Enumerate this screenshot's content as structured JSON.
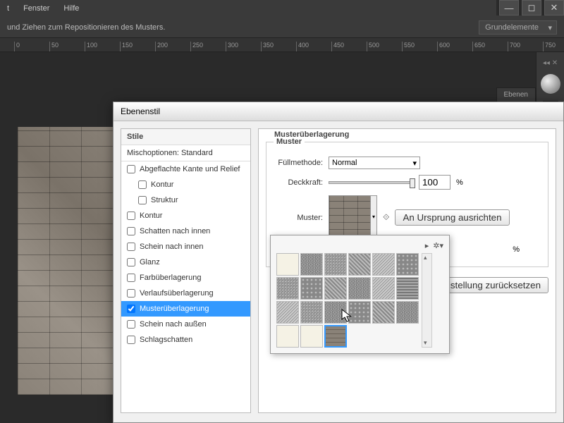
{
  "menu": {
    "item1": "t",
    "item2": "Fenster",
    "item3": "Hilfe"
  },
  "toolbar": {
    "hint": "und Ziehen zum Repositionieren des Musters.",
    "preset": "Grundelemente"
  },
  "ruler": [
    "0",
    "50",
    "100",
    "150",
    "200",
    "250",
    "300",
    "350",
    "400",
    "450",
    "500",
    "550",
    "600",
    "650",
    "700",
    "750"
  ],
  "panel_tab": "Ebenen",
  "dialog": {
    "title": "Ebenenstil",
    "styles_header": "Stile",
    "blend_options": "Mischoptionen: Standard",
    "items": [
      {
        "label": "Abgeflachte Kante und Relief",
        "checked": false
      },
      {
        "label": "Kontur",
        "checked": false,
        "indent": true
      },
      {
        "label": "Struktur",
        "checked": false,
        "indent": true
      },
      {
        "label": "Kontur",
        "checked": false
      },
      {
        "label": "Schatten nach innen",
        "checked": false
      },
      {
        "label": "Schein nach innen",
        "checked": false
      },
      {
        "label": "Glanz",
        "checked": false
      },
      {
        "label": "Farbüberlagerung",
        "checked": false
      },
      {
        "label": "Verlaufsüberlagerung",
        "checked": false
      },
      {
        "label": "Musterüberlagerung",
        "checked": true,
        "selected": true
      },
      {
        "label": "Schein nach außen",
        "checked": false
      },
      {
        "label": "Schlagschatten",
        "checked": false
      }
    ],
    "panel": {
      "title": "Musterüberlagerung",
      "subtitle": "Muster",
      "blend_label": "Füllmethode:",
      "blend_value": "Normal",
      "opacity_label": "Deckkraft:",
      "opacity_value": "100",
      "opacity_unit": "%",
      "pattern_label": "Muster:",
      "snap_btn": "An Ursprung ausrichten",
      "scale_unit": "%",
      "reset_btn": "deinstellung zurücksetzen"
    }
  },
  "picker": {
    "rows": [
      [
        "blank",
        "noise1",
        "noise2",
        "noise3",
        "noise4",
        "noise5"
      ],
      [
        "noise2",
        "noise5",
        "noise3",
        "noise1",
        "noise4",
        "noise6"
      ],
      [
        "noise4",
        "noise2",
        "noise1",
        "noise5",
        "noise3",
        "noise1"
      ],
      [
        "blank",
        "blank",
        "brick-selected",
        "",
        "",
        ""
      ]
    ]
  }
}
